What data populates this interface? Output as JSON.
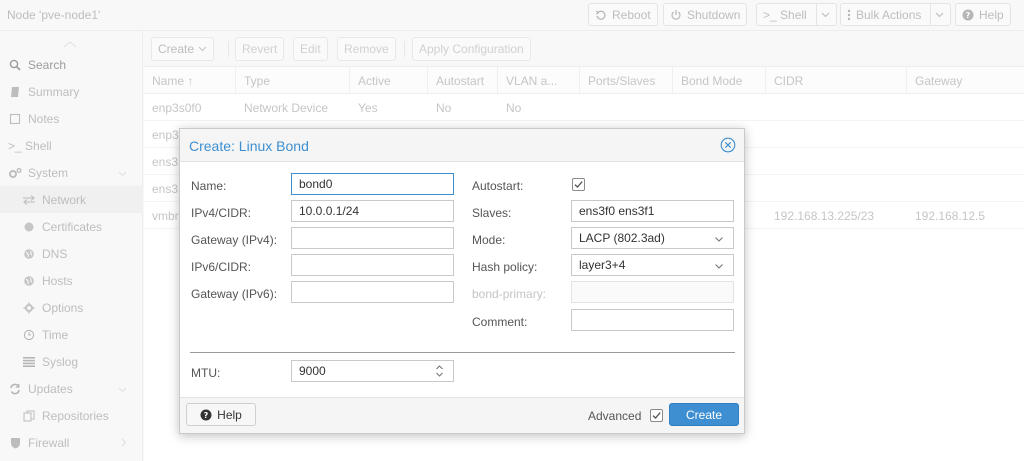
{
  "header": {
    "node_title": "Node 'pve-node1'",
    "buttons": {
      "reboot": "Reboot",
      "shutdown": "Shutdown",
      "shell": ">_ Shell",
      "bulk_actions": "Bulk Actions",
      "help": "Help"
    }
  },
  "sidebar": {
    "items": [
      {
        "label": "Search",
        "icon": "search-icon"
      },
      {
        "label": "Summary",
        "icon": "book-icon"
      },
      {
        "label": "Notes",
        "icon": "note-icon"
      },
      {
        "label": ">_ Shell",
        "icon": "terminal-icon"
      },
      {
        "label": "System",
        "icon": "gears-icon"
      },
      {
        "label": "Network",
        "icon": "exchange-icon"
      },
      {
        "label": "Certificates",
        "icon": "certificate-icon"
      },
      {
        "label": "DNS",
        "icon": "globe-icon"
      },
      {
        "label": "Hosts",
        "icon": "globe-icon"
      },
      {
        "label": "Options",
        "icon": "gear-icon"
      },
      {
        "label": "Time",
        "icon": "clock-icon"
      },
      {
        "label": "Syslog",
        "icon": "list-icon"
      },
      {
        "label": "Updates",
        "icon": "refresh-icon"
      },
      {
        "label": "Repositories",
        "icon": "files-icon"
      },
      {
        "label": "Firewall",
        "icon": "shield-icon"
      }
    ]
  },
  "toolbar": {
    "create": "Create",
    "revert": "Revert",
    "edit": "Edit",
    "remove": "Remove",
    "apply": "Apply Configuration"
  },
  "grid": {
    "columns": [
      "Name ↑",
      "Type",
      "Active",
      "Autostart",
      "VLAN a...",
      "Ports/Slaves",
      "Bond Mode",
      "CIDR",
      "Gateway"
    ],
    "rows": [
      {
        "name": "enp3s0f0",
        "type": "Network Device",
        "active": "Yes",
        "autostart": "No",
        "vlan": "No",
        "cidr": "",
        "gateway": ""
      },
      {
        "name": "enp3",
        "type": "",
        "active": "",
        "autostart": "",
        "vlan": "",
        "cidr": "",
        "gateway": ""
      },
      {
        "name": "ens3",
        "type": "",
        "active": "",
        "autostart": "",
        "vlan": "",
        "cidr": "",
        "gateway": ""
      },
      {
        "name": "ens3",
        "type": "",
        "active": "",
        "autostart": "",
        "vlan": "",
        "cidr": "",
        "gateway": ""
      },
      {
        "name": "vmbr",
        "type": "",
        "active": "",
        "autostart": "",
        "vlan": "",
        "cidr": "192.168.13.225/23",
        "gateway": "192.168.12.5"
      }
    ]
  },
  "dialog": {
    "title": "Create: Linux Bond",
    "labels": {
      "name": "Name:",
      "ipv4": "IPv4/CIDR:",
      "gw4": "Gateway (IPv4):",
      "ipv6": "IPv6/CIDR:",
      "gw6": "Gateway (IPv6):",
      "autostart": "Autostart:",
      "slaves": "Slaves:",
      "mode": "Mode:",
      "hash": "Hash policy:",
      "bond_primary": "bond-primary:",
      "comment": "Comment:",
      "mtu": "MTU:"
    },
    "values": {
      "name": "bond0",
      "ipv4": "10.0.0.1/24",
      "gw4": "",
      "ipv6": "",
      "gw6": "",
      "autostart": true,
      "slaves": "ens3f0 ens3f1",
      "mode": "LACP (802.3ad)",
      "hash": "layer3+4",
      "bond_primary": "",
      "comment": "",
      "mtu": "9000"
    },
    "footer": {
      "help": "Help",
      "advanced": "Advanced",
      "advanced_checked": true,
      "create": "Create"
    }
  },
  "colors": {
    "accent": "#3d8fd1"
  }
}
